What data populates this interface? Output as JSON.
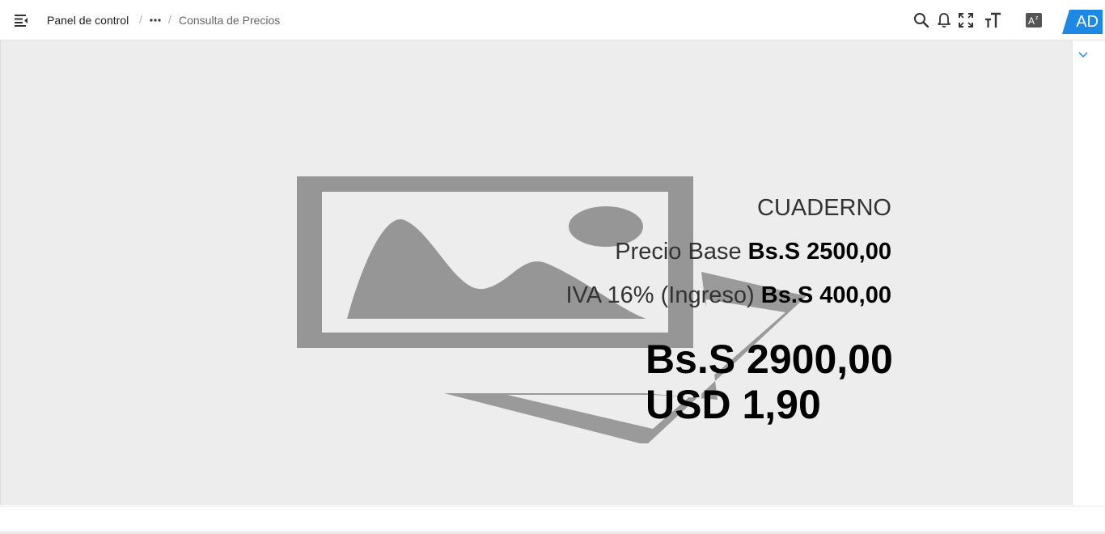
{
  "header": {
    "breadcrumb": {
      "home": "Panel de control",
      "separator": "/",
      "current": "Consulta de Precios"
    },
    "avatar_initials": "AD",
    "accent_color": "#1e88e5"
  },
  "icons": {
    "menu": "menu-collapse-icon",
    "more": "more-horizontal-icon",
    "search": "search-icon",
    "notifications": "bell-icon",
    "fullscreen": "fullscreen-icon",
    "font_size": "font-size-icon",
    "translate": "translate-icon",
    "side_toggle": "chevron-down-icon",
    "product_image": "image-placeholder-icon"
  },
  "product": {
    "name": "CUADERNO",
    "base_label": "Precio Base",
    "base_value": "Bs.S 2500,00",
    "tax_label": "IVA 16% (Ingreso)",
    "tax_value": "Bs.S 400,00",
    "total_bs": "Bs.S 2900,00",
    "total_usd": "USD 1,90"
  }
}
